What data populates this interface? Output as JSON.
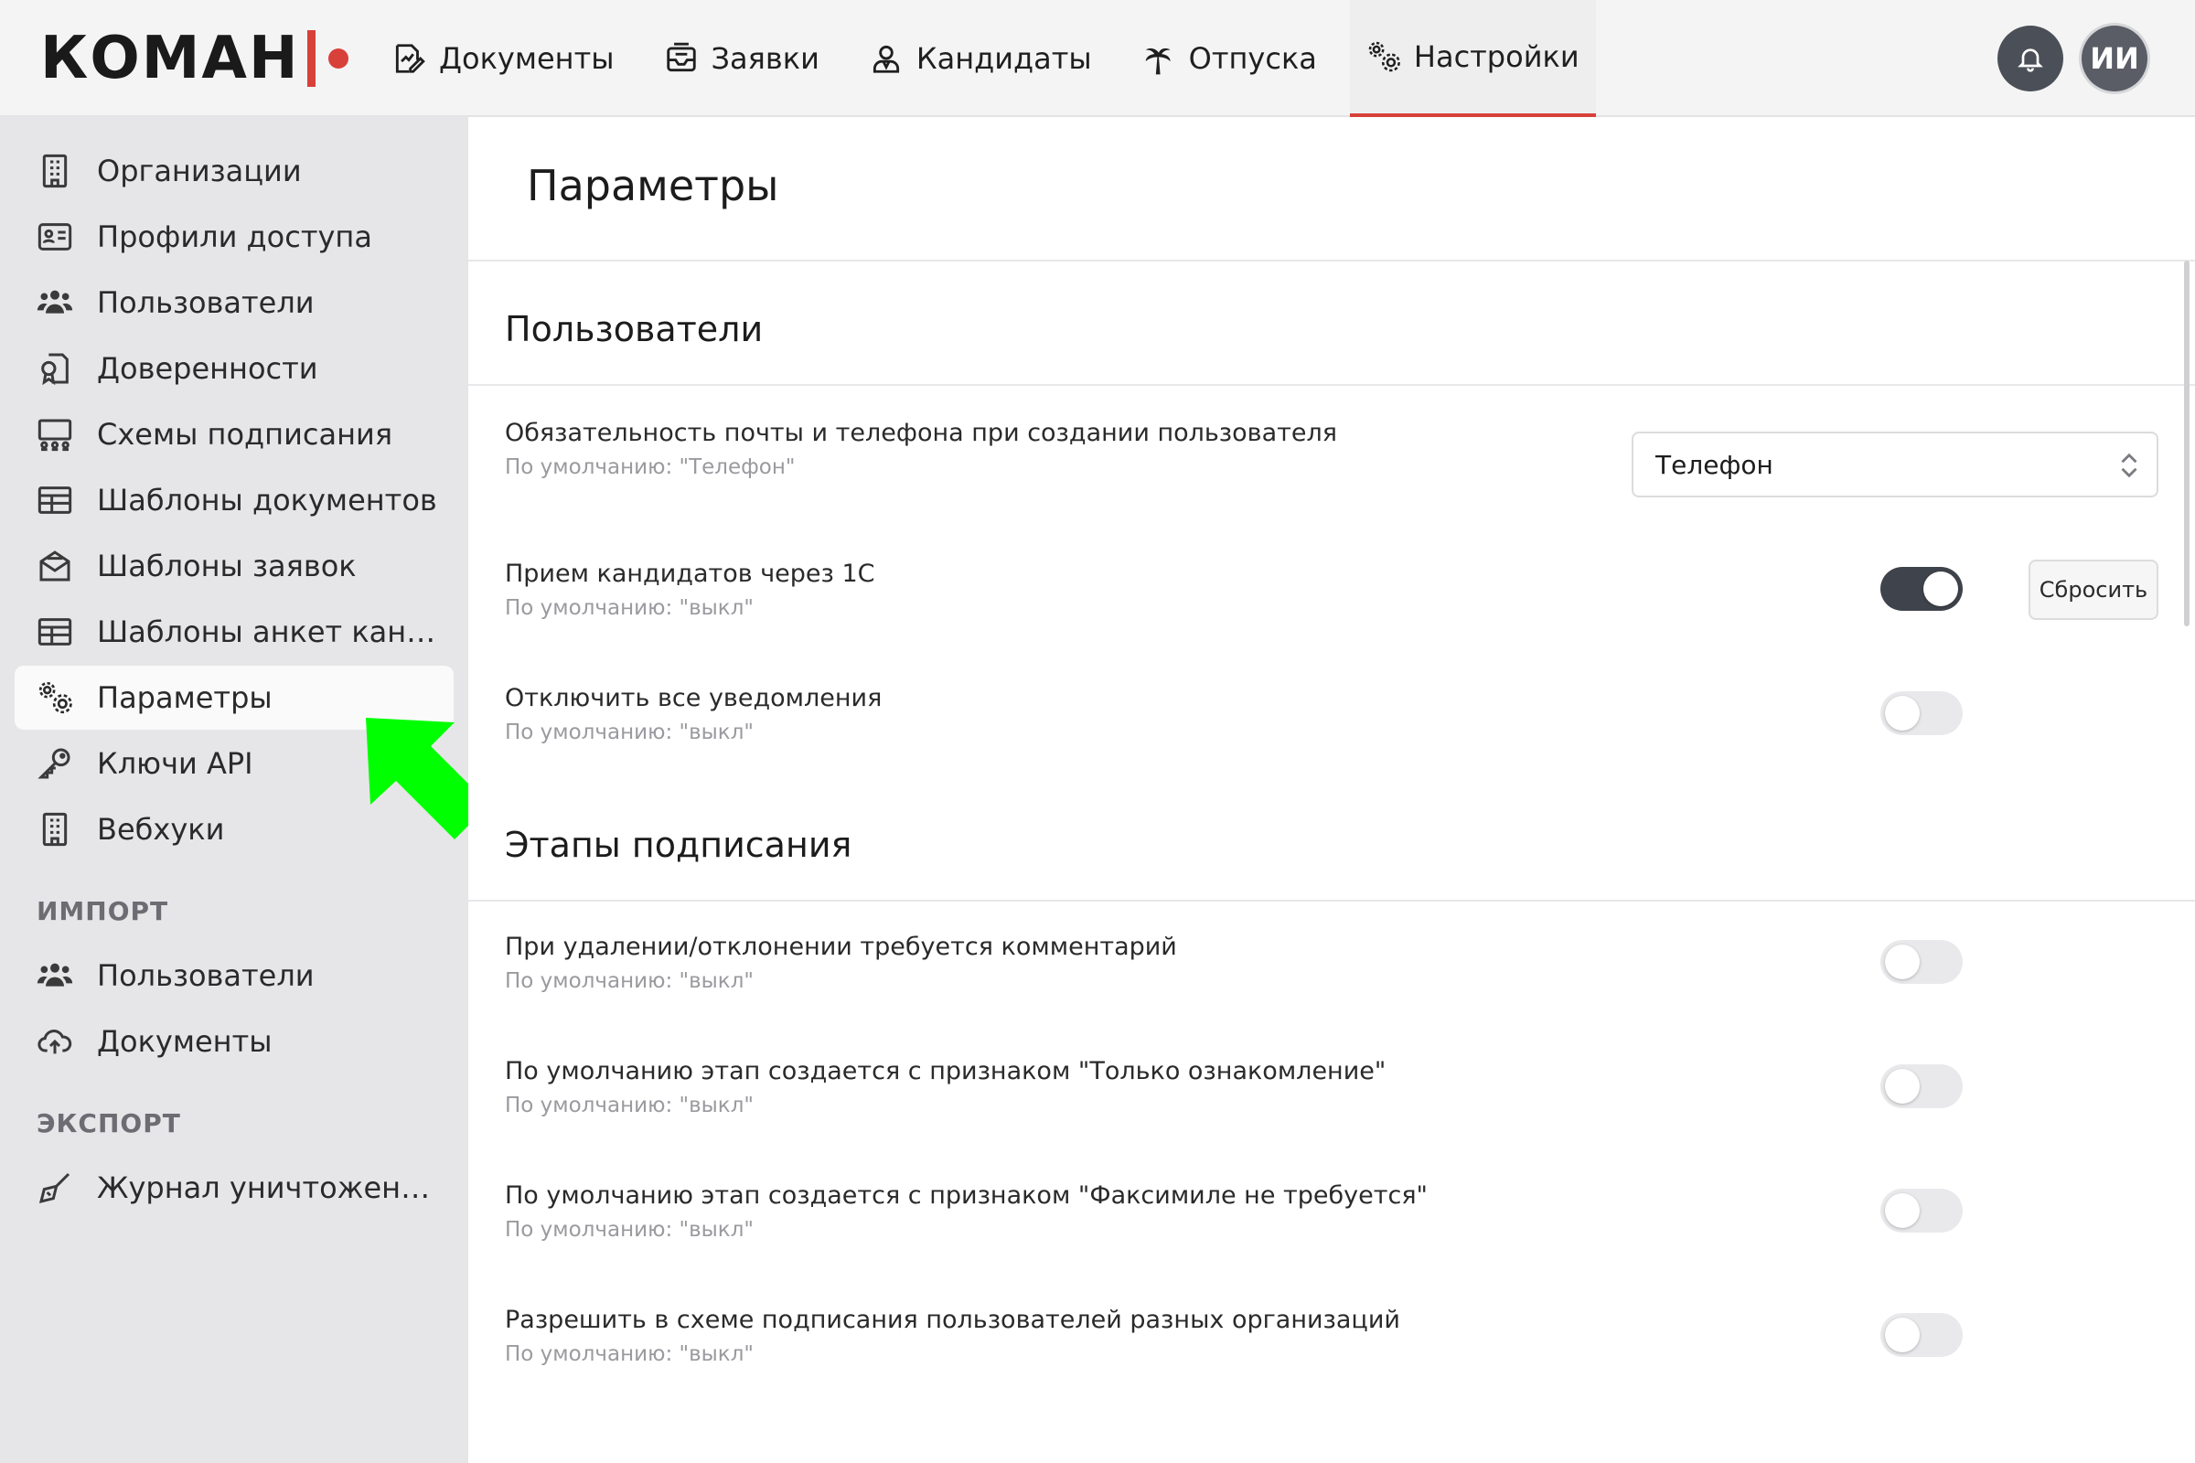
{
  "header": {
    "logo_text": "КОМАН",
    "brand_color": "#d8403a",
    "nav": [
      {
        "label": "Документы",
        "icon": "document-edit-icon"
      },
      {
        "label": "Заявки",
        "icon": "inbox-icon"
      },
      {
        "label": "Кандидаты",
        "icon": "person-icon"
      },
      {
        "label": "Отпуска",
        "icon": "palm-tree-icon"
      },
      {
        "label": "Настройки",
        "icon": "gears-icon",
        "active": true
      }
    ],
    "avatar_initials": "ИИ"
  },
  "sidebar": {
    "items": [
      {
        "label": "Организации",
        "icon": "building-icon"
      },
      {
        "label": "Профили доступа",
        "icon": "id-card-icon"
      },
      {
        "label": "Пользователи",
        "icon": "users-icon"
      },
      {
        "label": "Доверенности",
        "icon": "certificate-icon"
      },
      {
        "label": "Схемы подписания",
        "icon": "signing-scheme-icon"
      },
      {
        "label": "Шаблоны документов",
        "icon": "table-icon"
      },
      {
        "label": "Шаблоны заявок",
        "icon": "envelope-icon"
      },
      {
        "label": "Шаблоны анкет канд…",
        "icon": "table-icon"
      },
      {
        "label": "Параметры",
        "icon": "gears-icon",
        "active": true
      },
      {
        "label": "Ключи API",
        "icon": "key-icon"
      },
      {
        "label": "Вебхуки",
        "icon": "building-icon"
      }
    ],
    "import_title": "ИМПОРТ",
    "import_items": [
      {
        "label": "Пользователи",
        "icon": "users-icon"
      },
      {
        "label": "Документы",
        "icon": "cloud-upload-icon"
      }
    ],
    "export_title": "ЭКСПОРТ",
    "export_items": [
      {
        "label": "Журнал уничтожения …",
        "icon": "broom-icon"
      }
    ]
  },
  "main": {
    "title": "Параметры",
    "sections": [
      {
        "title": "Пользователи",
        "settings": [
          {
            "label": "Обязательность почты и телефона при создании пользователя",
            "default": "По умолчанию: \"Телефон\"",
            "type": "select",
            "value": "Телефон"
          },
          {
            "label": "Прием кандидатов через 1С",
            "default": "По умолчанию: \"выкл\"",
            "type": "toggle",
            "value": true,
            "reset_label": "Сбросить"
          },
          {
            "label": "Отключить все уведомления",
            "default": "По умолчанию: \"выкл\"",
            "type": "toggle",
            "value": false
          }
        ]
      },
      {
        "title": "Этапы подписания",
        "settings": [
          {
            "label": "При удалении/отклонении требуется комментарий",
            "default": "По умолчанию: \"выкл\"",
            "type": "toggle",
            "value": false
          },
          {
            "label": "По умолчанию этап создается с признаком \"Только ознакомление\"",
            "default": "По умолчанию: \"выкл\"",
            "type": "toggle",
            "value": false
          },
          {
            "label": "По умолчанию этап создается с признаком \"Факсимиле не требуется\"",
            "default": "По умолчанию: \"выкл\"",
            "type": "toggle",
            "value": false
          },
          {
            "label": "Разрешить в схеме подписания пользователей разных организаций",
            "default": "По умолчанию: \"выкл\"",
            "type": "toggle",
            "value": false
          }
        ]
      }
    ]
  },
  "colors": {
    "accent": "#d8403a",
    "toggle_on": "#3f434b",
    "toggle_off": "#e9e9ec",
    "sidebar_bg": "#e6e6e9",
    "annotation_arrow": "#00ff00"
  }
}
